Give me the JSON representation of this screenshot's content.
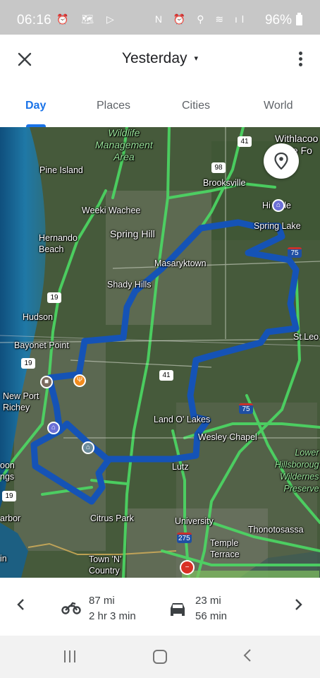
{
  "status_bar": {
    "time": "06:16",
    "left_icons": "⏰ 🗺 ▷",
    "right_icons": "N ⏰ ⚲ ≋ ıl",
    "battery": "96%"
  },
  "header": {
    "close_icon": "close-icon",
    "title": "Yesterday",
    "dropdown_icon": "▾",
    "more_icon": "more-vert-icon"
  },
  "tabs": [
    {
      "label": "Day",
      "active": true
    },
    {
      "label": "Places",
      "active": false
    },
    {
      "label": "Cities",
      "active": false
    },
    {
      "label": "World",
      "active": false
    }
  ],
  "map": {
    "labels": {
      "wildlife": "Wildlife\nManagement\nArea",
      "withlacoochee": "Withlacoo\nState Fo",
      "pine_island": "Pine Island",
      "brooksville": "Brooksville",
      "hill_dale": "Hi Dale",
      "weeki_wachee": "Weeki Wachee",
      "spring_hill": "Spring Hill",
      "spring_lake": "Spring Lake",
      "hernando_beach": "Hernando\nBeach",
      "masaryktown": "Masaryktown",
      "shady_hills": "Shady Hills",
      "hudson": "Hudson",
      "st_leo": "St Leo",
      "bayonet_point": "Bayonet Point",
      "new_port_richey": "New Port\nRichey",
      "land_o_lakes": "Land O' Lakes",
      "wesley_chapel": "Wesley Chapel",
      "lower_hillsborough": "Lower\nHillsboroug\nWildernes\nPreserve",
      "holiday": "oon\nngs",
      "lutz": "Lutz",
      "harbor": "arbor",
      "citrus_park": "Citrus Park",
      "university": "University",
      "thonotosassa": "Thonotosassa",
      "temple_terrace": "Temple\nTerrace",
      "town_n_country": "Town 'N'\nCountry",
      "edge_in": "in"
    },
    "shields": {
      "us41_top": "41",
      "sr98": "98",
      "us19_a": "19",
      "us19_b": "19",
      "us19_c": "19",
      "us41_mid": "41",
      "i75_a": "75",
      "i75_b": "75",
      "i275": "275"
    },
    "location_button_icon": "location-pin-icon"
  },
  "summary": {
    "prev_icon": "chevron-left-icon",
    "next_icon": "chevron-right-icon",
    "motorcycle": {
      "icon": "motorcycle-icon",
      "distance": "87 mi",
      "duration": "2 hr 3 min"
    },
    "car": {
      "icon": "car-icon",
      "distance": "23 mi",
      "duration": "56 min"
    }
  },
  "colors": {
    "accent": "#1a73e8",
    "route": "#1553b6",
    "road": "#4cd964"
  }
}
